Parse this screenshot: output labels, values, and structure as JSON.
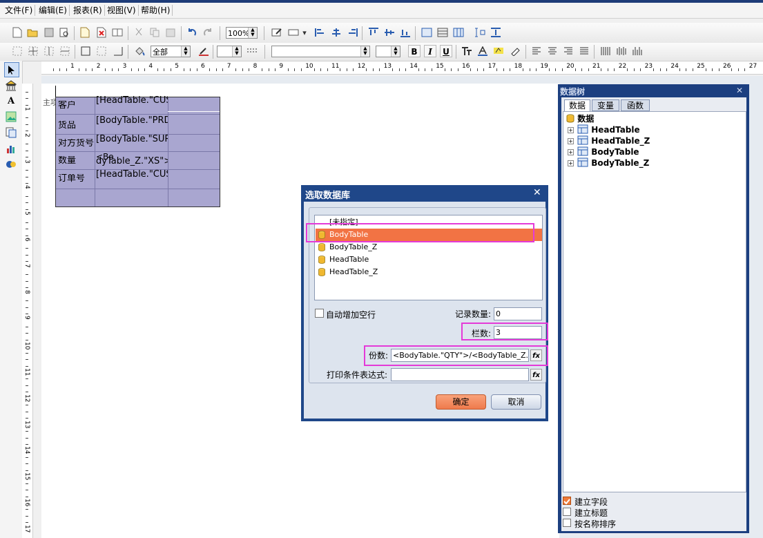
{
  "menu": [
    "文件(F)",
    "编辑(E)",
    "报表(R)",
    "视图(V)",
    "帮助(H)"
  ],
  "toolbar1": {
    "zoom": "100%"
  },
  "toolbar2": {
    "border_combo": "全部",
    "bold": "B",
    "italic": "I",
    "underline": "U"
  },
  "palette": [
    "pointer-icon",
    "bank-icon",
    "text-icon",
    "image-icon",
    "barcode-icon",
    "chart-icon",
    "subreport-icon"
  ],
  "palette_text_tool": "A",
  "ruler": {
    "h": [
      "1",
      "2",
      "3",
      "4",
      "5",
      "6",
      "7",
      "8",
      "9",
      "10",
      "11",
      "12",
      "13",
      "14",
      "15",
      "16",
      "17",
      "18",
      "19",
      "20",
      "21",
      "22",
      "23",
      "24",
      "25",
      "26",
      "27"
    ],
    "v": [
      "1",
      "2",
      "3",
      "4",
      "5",
      "6",
      "7",
      "8",
      "9",
      "10",
      "11",
      "12",
      "13",
      "14",
      "15",
      "16",
      "17"
    ]
  },
  "report": {
    "side_label": "主项",
    "rows": [
      {
        "label": "客户",
        "value": "[HeadTable.\"CUS_NO\"]"
      },
      {
        "label": "货品",
        "value": "[BodyTable.\"PRD_NO\"]"
      },
      {
        "label": "对方货号",
        "value": "[BodyTable.\"SUP_PRD_NO\"]"
      },
      {
        "label": "数量",
        "value": "dyTable_Z.\"XS\">"
      },
      {
        "label": "订单号",
        "value": "[HeadTable.\"CUS_OS_NO\"]"
      }
    ],
    "row3_overlap": "<Bo"
  },
  "tree": {
    "title": "数据树",
    "close": "✕",
    "tabs": [
      "数据",
      "变量",
      "函数"
    ],
    "root": "数据",
    "nodes": [
      "HeadTable",
      "HeadTable_Z",
      "BodyTable",
      "BodyTable_Z"
    ],
    "options": [
      {
        "label": "建立字段",
        "checked": true
      },
      {
        "label": "建立标题",
        "checked": false
      },
      {
        "label": "按名称排序",
        "checked": false
      }
    ]
  },
  "dialog": {
    "title": "选取数据库",
    "close": "✕",
    "items": [
      "[未指定]",
      "BodyTable",
      "BodyTable_Z",
      "HeadTable",
      "HeadTable_Z"
    ],
    "selected": "BodyTable",
    "auto_add_label": "自动增加空行",
    "record_count_label": "记录数量:",
    "record_count_value": "0",
    "columns_label": "栏数:",
    "columns_value": "3",
    "copies_label": "份数:",
    "copies_value": "<BodyTable.\"QTY\">/<BodyTable_Z.\"XS\">",
    "print_cond_label": "打印条件表达式:",
    "print_cond_value": "",
    "fx": "fx",
    "ok": "确定",
    "cancel": "取消"
  },
  "colors": {
    "selection": "#f27344",
    "highlight": "#e43ad8",
    "dialog_frame": "#1f4789",
    "report_fill": "#a9a6d0"
  }
}
